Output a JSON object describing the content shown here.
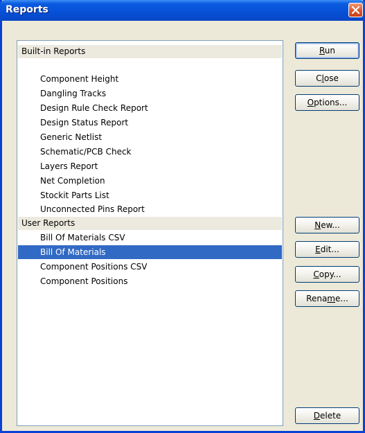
{
  "window": {
    "title": "Reports"
  },
  "list": {
    "builtin_header": "Built-in Reports",
    "builtin_items": [
      "Component Height",
      "Dangling Tracks",
      "Design Rule Check Report",
      "Design Status Report",
      "Generic Netlist",
      "Schematic/PCB Check",
      "Layers Report",
      "Net Completion",
      "Stockit Parts List",
      "Unconnected Pins Report"
    ],
    "user_header": "User Reports",
    "user_items": [
      "Bill Of Materials CSV",
      "Bill Of Materials",
      "Component Positions CSV",
      "Component Positions"
    ],
    "selected": "Bill Of Materials"
  },
  "buttons": {
    "run": {
      "pre": "",
      "key": "R",
      "post": "un"
    },
    "close": {
      "pre": "C",
      "key": "l",
      "post": "ose"
    },
    "options": {
      "pre": "",
      "key": "O",
      "post": "ptions..."
    },
    "new": {
      "pre": "",
      "key": "N",
      "post": "ew..."
    },
    "edit": {
      "pre": "",
      "key": "E",
      "post": "dit..."
    },
    "copy": {
      "pre": "",
      "key": "C",
      "post": "opy..."
    },
    "rename": {
      "pre": "Rena",
      "key": "m",
      "post": "e..."
    },
    "delete": {
      "pre": "",
      "key": "D",
      "post": "elete"
    }
  },
  "colors": {
    "title_bar": "#0650d6",
    "selection": "#316ac5",
    "close_button": "#e0542b"
  }
}
